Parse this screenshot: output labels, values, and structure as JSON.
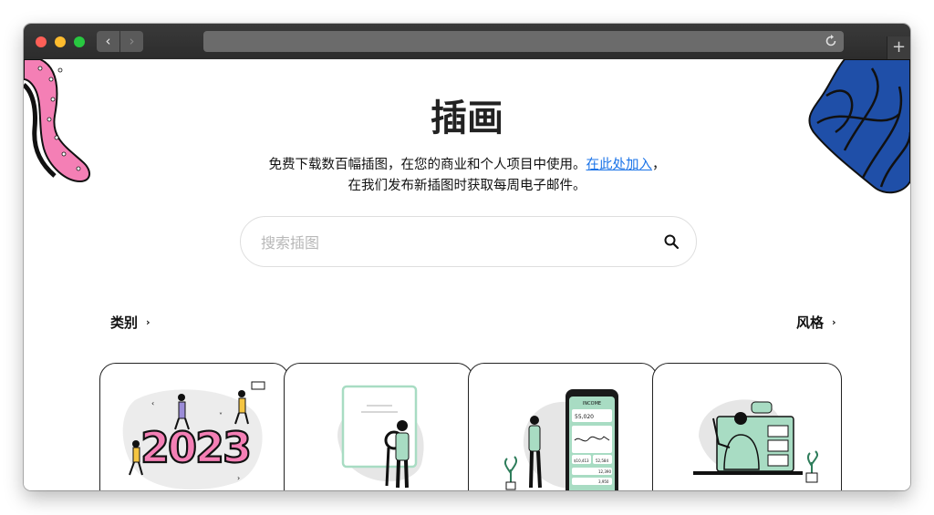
{
  "browser": {
    "back_label": "‹",
    "forward_label": "›",
    "new_tab_label": "+"
  },
  "page": {
    "title": "插画",
    "description_line1": "免费下载数百幅插图，在您的商业和个人项目中使用。",
    "join_link": "在此处加入",
    "description_comma": "，",
    "description_line2": "在我们发布新插图时获取每周电子邮件。"
  },
  "search": {
    "placeholder": "搜索插图"
  },
  "categories": {
    "left_label": "类别",
    "right_label": "风格",
    "chevron": "›"
  },
  "cards": [
    {
      "name": "2023",
      "digits": "2023"
    },
    {
      "name": "whiteboard"
    },
    {
      "name": "finance-app",
      "phone_header": "INCOME",
      "balance": "55,020",
      "stat1": "$10,413",
      "stat2": "52,584",
      "row1": "12,390",
      "row2": "3,950"
    },
    {
      "name": "video-call"
    }
  ],
  "colors": {
    "pink": "#f47fb5",
    "blue_blob": "#1f4fa8",
    "mint": "#a8dcc3",
    "link": "#1a73e8"
  }
}
